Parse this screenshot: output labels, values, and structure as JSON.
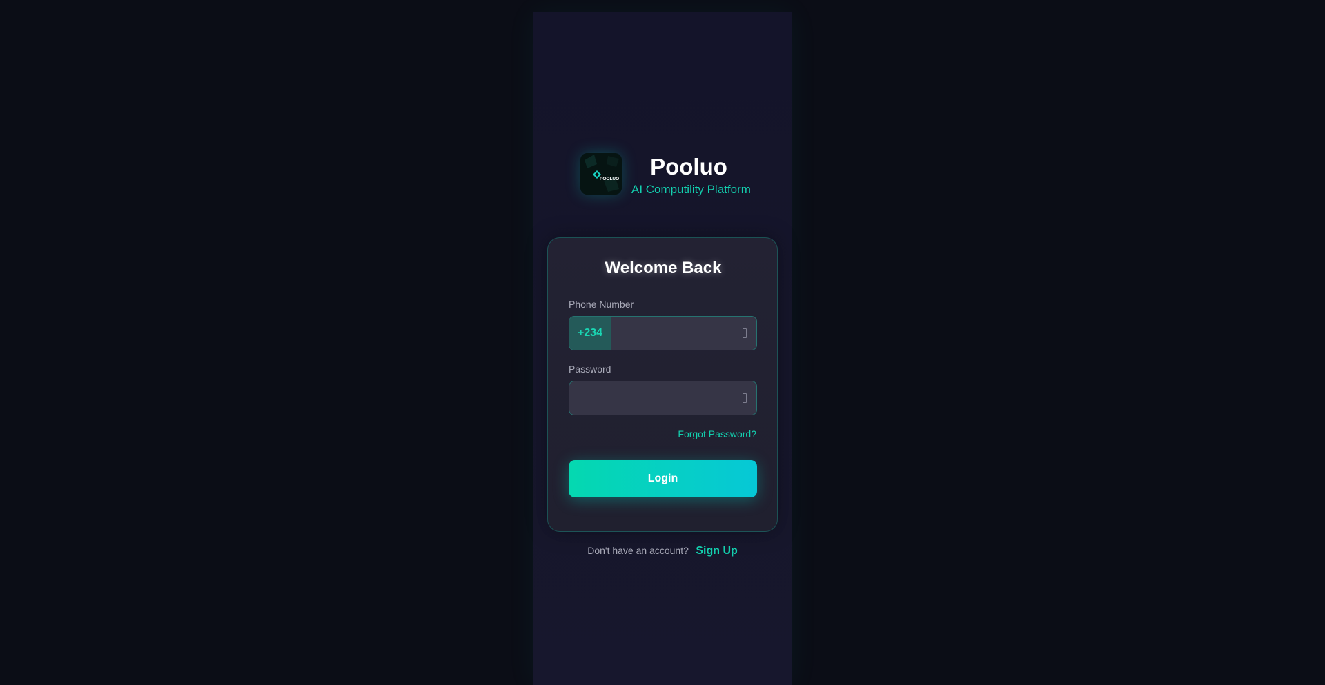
{
  "brand": {
    "logo_text": "POOLUO",
    "name": "Pooluo",
    "tagline": "AI Computility Platform"
  },
  "login_card": {
    "title": "Welcome Back",
    "phone": {
      "label": "Phone Number",
      "country_code": "+234",
      "value": "",
      "placeholder": ""
    },
    "password": {
      "label": "Password",
      "value": "",
      "placeholder": ""
    },
    "forgot_password_label": "Forgot Password?",
    "login_button_label": "Login"
  },
  "signup": {
    "prompt": "Don't have an account?",
    "link_label": "Sign Up"
  },
  "colors": {
    "background": "#0b0d16",
    "accent": "#13cfae",
    "button_gradient_start": "#05d8b0",
    "button_gradient_end": "#06c8d6",
    "card_border": "#14bea5"
  },
  "icons": {
    "phone_field": "phone-icon",
    "password_field": "lock-icon"
  }
}
